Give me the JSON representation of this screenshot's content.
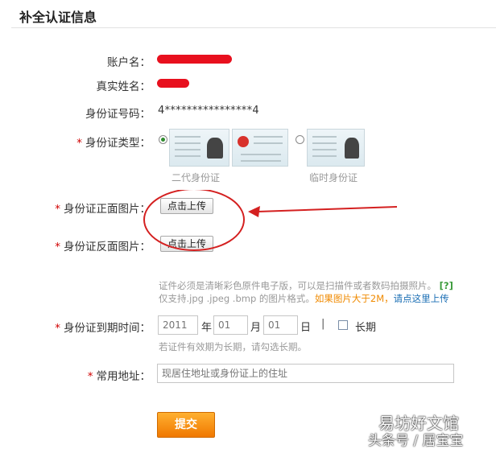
{
  "page": {
    "title": "补全认证信息"
  },
  "fields": {
    "account_label": "账户名：",
    "realname_label": "真实姓名：",
    "idnum_label": "身份证号码：",
    "idnum_value": "4****************4",
    "idtype_label": "身份证类型：",
    "front_label": "身份证正面图片：",
    "back_label": "身份证反面图片：",
    "expire_label": "身份证到期时间：",
    "address_label": "常用地址："
  },
  "required_mark": "*",
  "idtype": {
    "options": [
      {
        "caption": "二代身份证",
        "selected": true
      },
      {
        "caption": "临时身份证",
        "selected": false
      }
    ]
  },
  "upload": {
    "front_button": "点击上传",
    "back_button": "点击上传"
  },
  "hint": {
    "line1": "证件必须是清晰彩色原件电子版，可以是扫描件或者数码拍摄照片。",
    "help": "[?]",
    "line2_prefix": "仅支持.jpg .jpeg .bmp 的图片格式。",
    "line2_orange": "如果图片大于2M，",
    "line2_link": "请点这里上传"
  },
  "expire": {
    "year_placeholder": "2011",
    "year_unit": "年",
    "month_placeholder": "01",
    "month_unit": "月",
    "day_placeholder": "01",
    "day_unit": "日",
    "separator": "|",
    "longterm_label": "长期",
    "longterm_checked": false,
    "hint": "若证件有效期为长期，请勾选长期。"
  },
  "address": {
    "placeholder": "现居住地址或身份证上的住址"
  },
  "submit_label": "提交",
  "watermark": {
    "line1": "易坊好文馆",
    "line2": "头条号 / 居宝宝"
  },
  "colors": {
    "accent": "#f07800",
    "required": "#d00000",
    "annotation": "#d42020",
    "link": "#1a6eb4"
  }
}
